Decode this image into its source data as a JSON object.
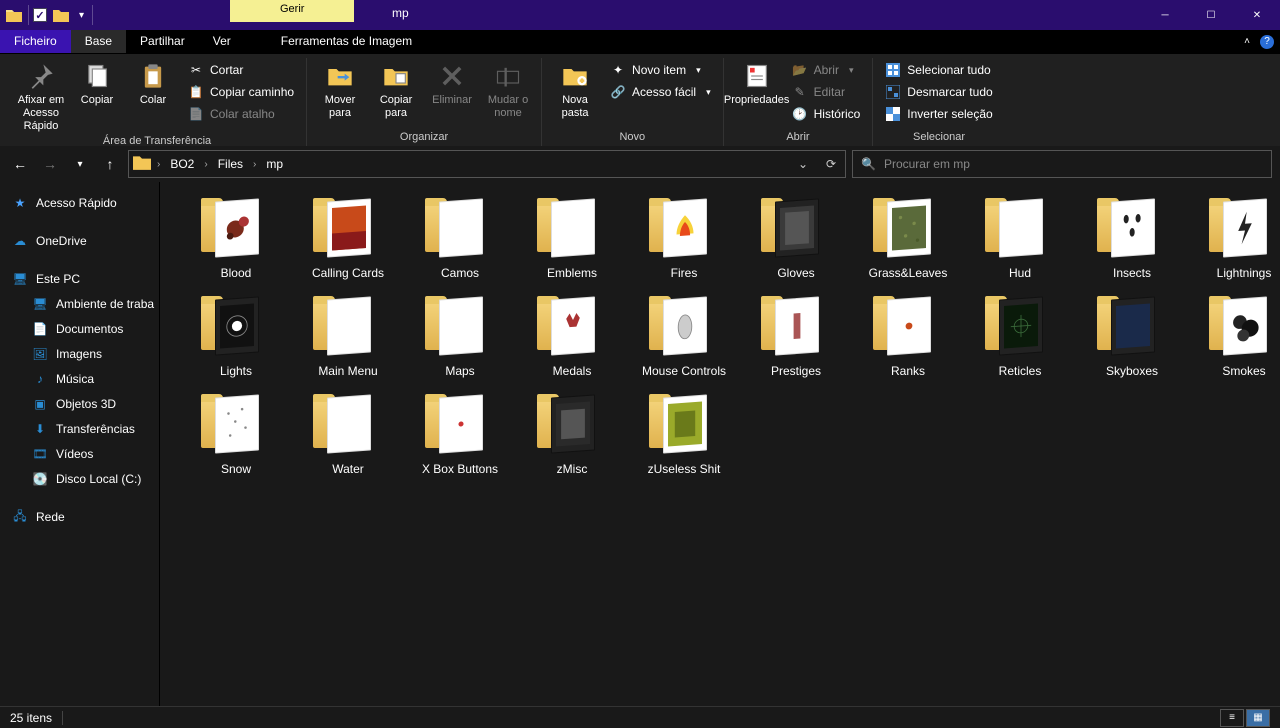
{
  "window": {
    "contextual_tab": "Gerir",
    "title": "mp"
  },
  "tabs": {
    "file": "Ficheiro",
    "base": "Base",
    "share": "Partilhar",
    "view": "Ver",
    "image_tools": "Ferramentas de Imagem"
  },
  "ribbon": {
    "clipboard": {
      "pin": "Afixar em Acesso Rápido",
      "copy": "Copiar",
      "paste": "Colar",
      "cut": "Cortar",
      "copy_path": "Copiar caminho",
      "paste_shortcut": "Colar atalho",
      "group": "Área de Transferência"
    },
    "organize": {
      "move_to": "Mover para",
      "copy_to": "Copiar para",
      "delete": "Eliminar",
      "rename": "Mudar o nome",
      "group": "Organizar"
    },
    "new": {
      "new_folder": "Nova pasta",
      "new_item": "Novo item",
      "easy_access": "Acesso fácil",
      "group": "Novo"
    },
    "open": {
      "properties": "Propriedades",
      "open": "Abrir",
      "edit": "Editar",
      "history": "Histórico",
      "group": "Abrir"
    },
    "select": {
      "select_all": "Selecionar tudo",
      "select_none": "Desmarcar tudo",
      "invert": "Inverter seleção",
      "group": "Selecionar"
    }
  },
  "breadcrumbs": [
    "BO2",
    "Files",
    "mp"
  ],
  "search": {
    "placeholder": "Procurar em mp"
  },
  "sidebar": {
    "quick_access": "Acesso Rápido",
    "onedrive": "OneDrive",
    "this_pc": "Este PC",
    "desktop": "Ambiente de traba",
    "documents": "Documentos",
    "pictures": "Imagens",
    "music": "Música",
    "objects3d": "Objetos 3D",
    "downloads": "Transferências",
    "videos": "Vídeos",
    "local_disk": "Disco Local (C:)",
    "network": "Rede"
  },
  "folders": [
    {
      "name": "Blood",
      "preview": "splat-red"
    },
    {
      "name": "Calling Cards",
      "preview": "orange-red"
    },
    {
      "name": "Camos",
      "preview": "blank"
    },
    {
      "name": "Emblems",
      "preview": "blank"
    },
    {
      "name": "Fires",
      "preview": "fire"
    },
    {
      "name": "Gloves",
      "preview": "texture-dark"
    },
    {
      "name": "Grass&Leaves",
      "preview": "green-noise"
    },
    {
      "name": "Hud",
      "preview": "blank"
    },
    {
      "name": "Insects",
      "preview": "bugs"
    },
    {
      "name": "Lightnings",
      "preview": "bolt"
    },
    {
      "name": "Lights",
      "preview": "light-dark"
    },
    {
      "name": "Main Menu",
      "preview": "blank"
    },
    {
      "name": "Maps",
      "preview": "blank"
    },
    {
      "name": "Medals",
      "preview": "medal"
    },
    {
      "name": "Mouse Controls",
      "preview": "mouse"
    },
    {
      "name": "Prestiges",
      "preview": "prestige"
    },
    {
      "name": "Ranks",
      "preview": "rank"
    },
    {
      "name": "Reticles",
      "preview": "reticle-dark"
    },
    {
      "name": "Skyboxes",
      "preview": "sky-dark"
    },
    {
      "name": "Smokes",
      "preview": "smoke"
    },
    {
      "name": "Snow",
      "preview": "snow"
    },
    {
      "name": "Water",
      "preview": "blank"
    },
    {
      "name": "X Box Buttons",
      "preview": "dot"
    },
    {
      "name": "zMisc",
      "preview": "misc-dark"
    },
    {
      "name": "zUseless Shit",
      "preview": "green-box"
    }
  ],
  "status": {
    "count": "25 itens"
  }
}
